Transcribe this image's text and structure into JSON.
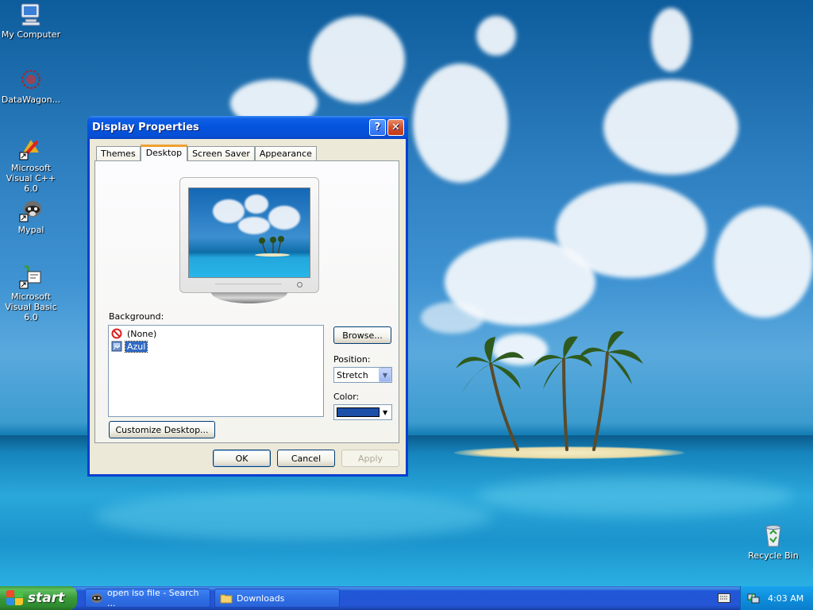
{
  "desktop": {
    "icons": [
      {
        "label": "My Computer",
        "icon": "my-computer-icon"
      },
      {
        "label": "DataWagon...",
        "icon": "datawagon-icon"
      },
      {
        "label": "Microsoft Visual C++ 6.0",
        "icon": "visual-cpp-icon"
      },
      {
        "label": "Mypal",
        "icon": "mypal-icon"
      },
      {
        "label": "Microsoft Visual Basic 6.0",
        "icon": "visual-basic-icon"
      },
      {
        "label": "Recycle Bin",
        "icon": "recycle-bin-icon"
      }
    ]
  },
  "dialog": {
    "title": "Display Properties",
    "help_glyph": "?",
    "close_glyph": "✕",
    "tabs": [
      "Themes",
      "Desktop",
      "Screen Saver",
      "Appearance"
    ],
    "active_tab": "Desktop",
    "background_label": "Background:",
    "background_items": [
      {
        "label": "(None)",
        "icon": "no-symbol-icon",
        "selected": false
      },
      {
        "label": "Azul",
        "icon": "image-file-icon",
        "selected": true
      }
    ],
    "browse_label": "Browse...",
    "position_label": "Position:",
    "position_value": "Stretch",
    "color_label": "Color:",
    "color_value": "#1c4fa8",
    "customize_label": "Customize Desktop...",
    "ok_label": "OK",
    "cancel_label": "Cancel",
    "apply_label": "Apply"
  },
  "taskbar": {
    "start_label": "start",
    "items": [
      {
        "label": "open iso file - Search ...",
        "icon": "mypal-icon"
      },
      {
        "label": "Downloads",
        "icon": "folder-icon"
      }
    ],
    "clock": "4:03 AM"
  },
  "colors": {
    "taskbar_blue": "#2456d6",
    "start_green": "#3a9a3a",
    "title_blue": "#0453dc",
    "dialog_face": "#ece9d8",
    "selection_blue": "#316ac5"
  }
}
